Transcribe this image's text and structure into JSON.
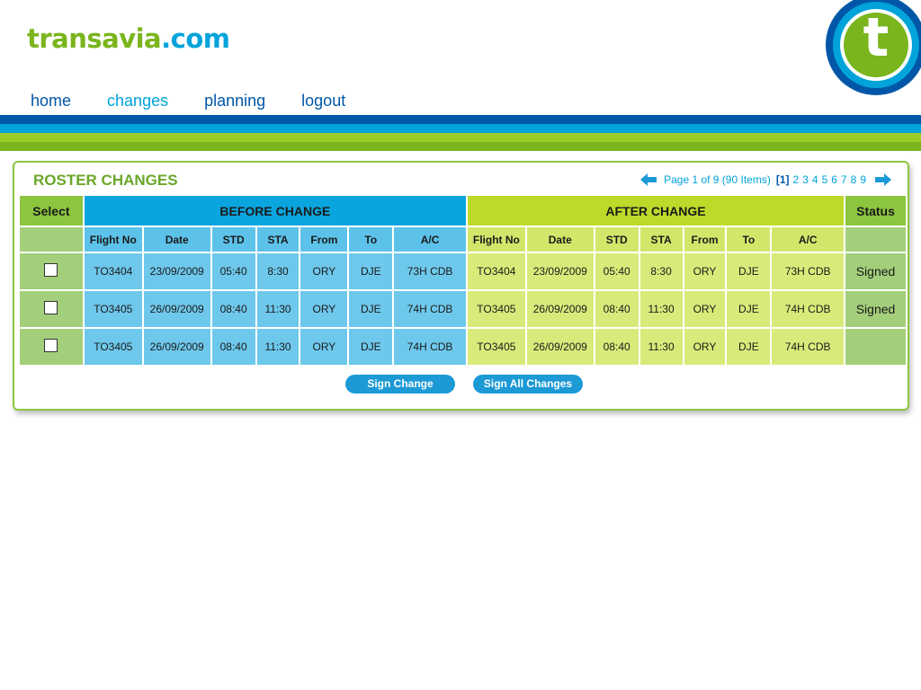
{
  "logo": {
    "main": "transavia",
    "suffix": ".com",
    "badge_letter": "t"
  },
  "nav": {
    "items": [
      "home",
      "changes",
      "planning",
      "logout"
    ],
    "active_index": 1
  },
  "roster": {
    "title": "ROSTER CHANGES",
    "pager": {
      "summary": "Page 1 of 9 (90 Items)",
      "current": "[1]",
      "pages": [
        "2",
        "3",
        "4",
        "5",
        "6",
        "7",
        "8",
        "9"
      ]
    },
    "headers": {
      "select": "Select",
      "before": "BEFORE CHANGE",
      "after": "AFTER CHANGE",
      "status": "Status",
      "columns": [
        "Flight No",
        "Date",
        "STD",
        "STA",
        "From",
        "To",
        "A/C"
      ]
    },
    "rows": [
      {
        "before": [
          "TO3404",
          "23/09/2009",
          "05:40",
          "8:30",
          "ORY",
          "DJE",
          "73H CDB"
        ],
        "after": [
          "TO3404",
          "23/09/2009",
          "05:40",
          "8:30",
          "ORY",
          "DJE",
          "73H CDB"
        ],
        "status": "Signed"
      },
      {
        "before": [
          "TO3405",
          "26/09/2009",
          "08:40",
          "11:30",
          "ORY",
          "DJE",
          "74H CDB"
        ],
        "after": [
          "TO3405",
          "26/09/2009",
          "08:40",
          "11:30",
          "ORY",
          "DJE",
          "74H CDB"
        ],
        "status": "Signed"
      },
      {
        "before": [
          "TO3405",
          "26/09/2009",
          "08:40",
          "11:30",
          "ORY",
          "DJE",
          "74H CDB"
        ],
        "after": [
          "TO3405",
          "26/09/2009",
          "08:40",
          "11:30",
          "ORY",
          "DJE",
          "74H CDB"
        ],
        "status": ""
      }
    ],
    "buttons": {
      "sign": "Sign Change",
      "sign_all": "Sign All Changes"
    }
  },
  "icons": {
    "prev": "left-arrow-icon",
    "next": "right-arrow-icon",
    "checkbox": "checkbox-unchecked-icon"
  },
  "colors": {
    "navy": "#0057a8",
    "cyan": "#00a3da",
    "green": "#7ab51d",
    "lime": "#bfd92a"
  }
}
